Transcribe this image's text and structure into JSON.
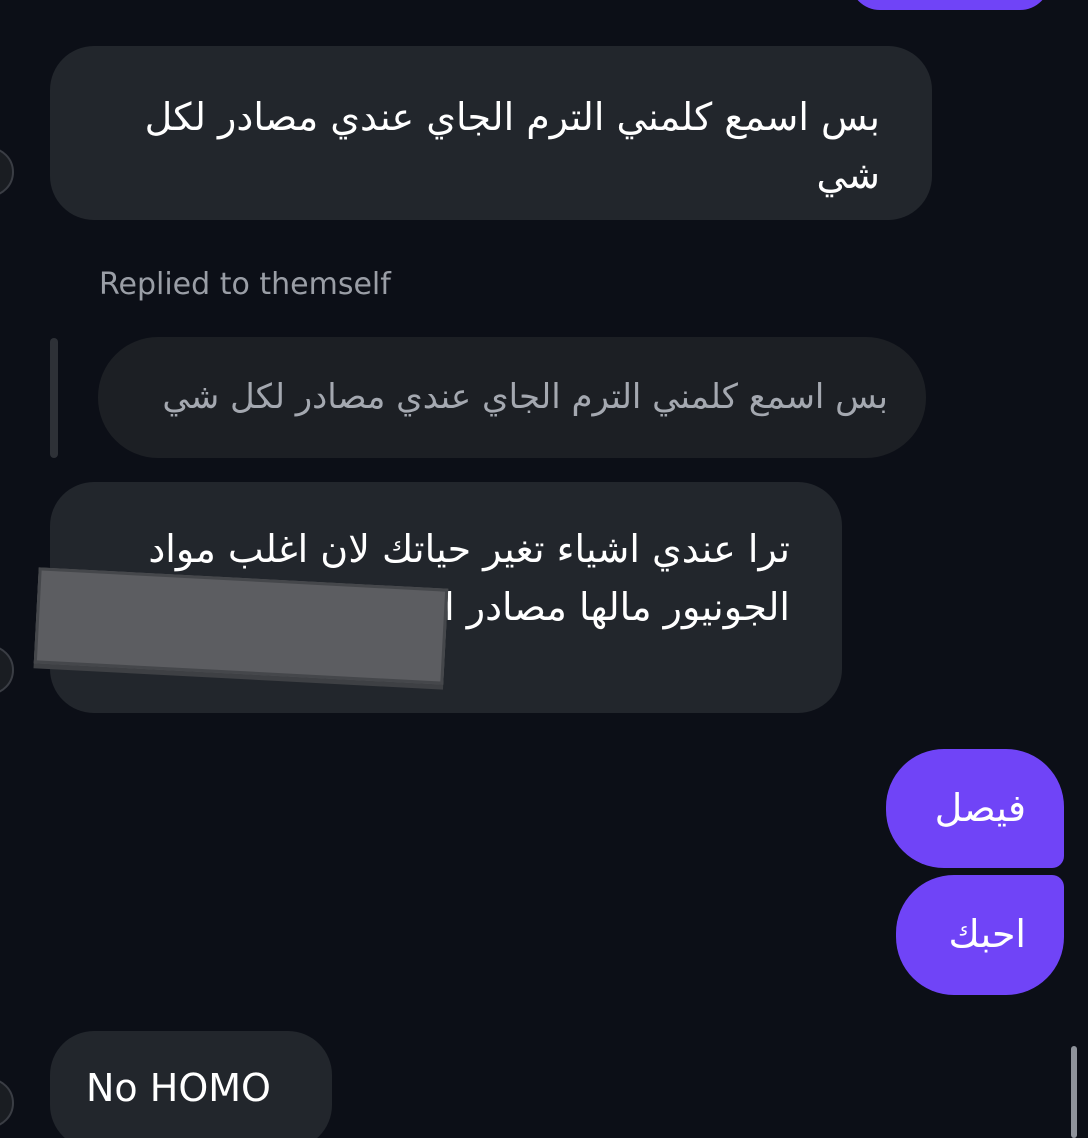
{
  "messages": {
    "m1": "بس اسمع كلمني الترم الجاي عندي مصادر لكل شي",
    "reply_label": "Replied to themself",
    "quoted": "بس اسمع كلمني الترم الجاي عندي مصادر لكل شي",
    "m2_line1": "ترا عندي اشياء تغير حياتك لان اغلب مواد",
    "m2_line2": "الجونيور مالها مصادر احفظ",
    "sent1": "فيصل",
    "sent2": "احبك",
    "m3": "No HOMO"
  },
  "colors": {
    "background": "#0c0f17",
    "received_bubble": "#22262c",
    "sent_bubble": "#7044f7"
  }
}
